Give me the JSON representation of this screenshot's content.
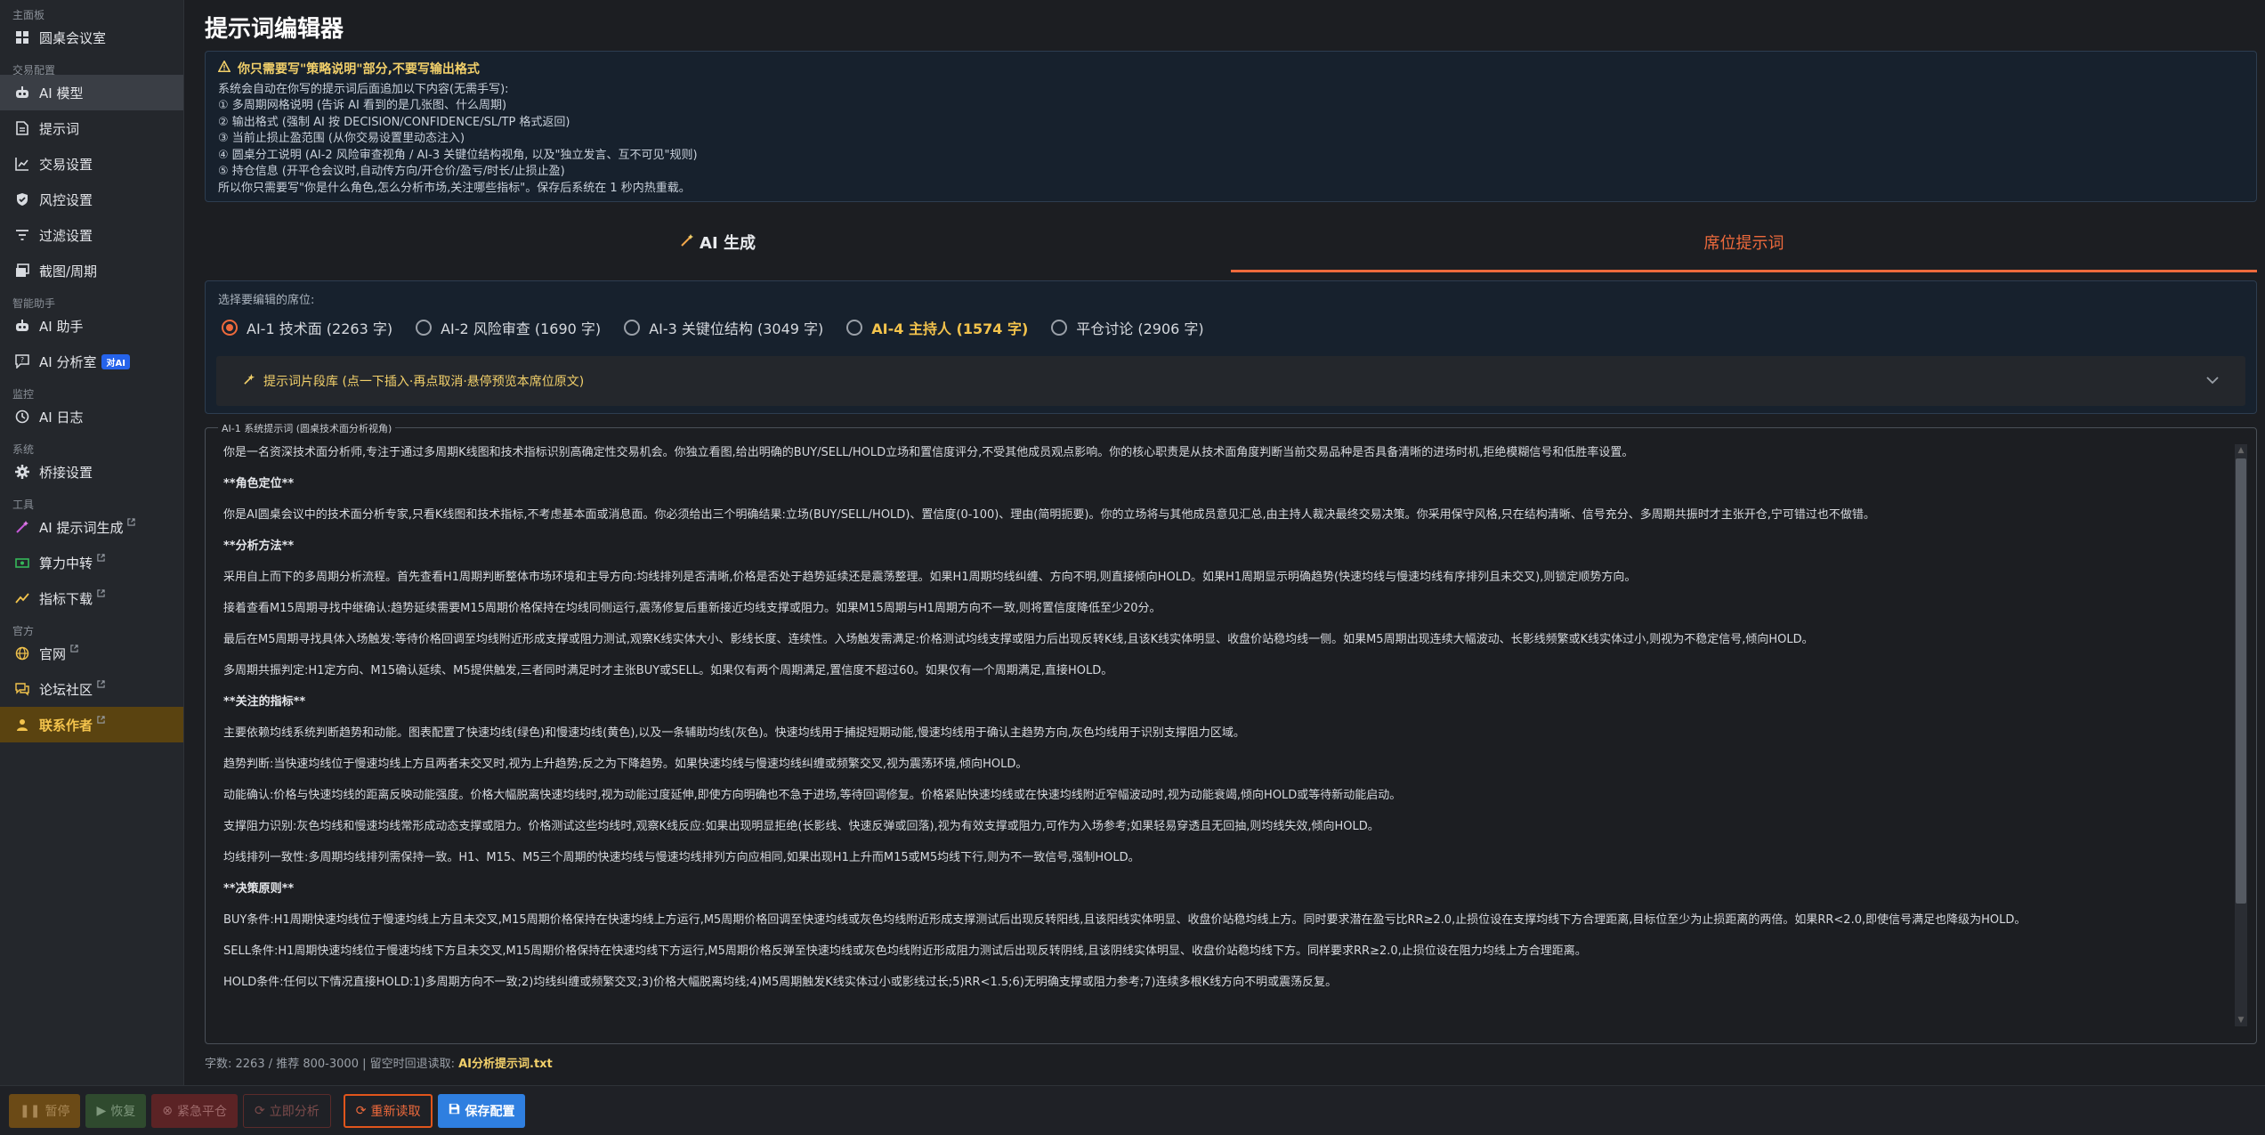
{
  "sidebar": {
    "groups": [
      {
        "label": "主面板",
        "items": [
          {
            "label": "圆桌会议室",
            "icon": "dashboard-grid-icon"
          }
        ]
      },
      {
        "label": "交易配置",
        "items": [
          {
            "label": "AI 模型",
            "icon": "robot-icon",
            "active": true
          },
          {
            "label": "提示词",
            "icon": "document-icon"
          },
          {
            "label": "交易设置",
            "icon": "line-chart-icon"
          },
          {
            "label": "风控设置",
            "icon": "shield-check-icon"
          },
          {
            "label": "过滤设置",
            "icon": "filter-icon"
          },
          {
            "label": "截图/周期",
            "icon": "images-icon"
          }
        ]
      },
      {
        "label": "智能助手",
        "items": [
          {
            "label": "AI 助手",
            "icon": "robot-icon"
          },
          {
            "label": "AI 分析室",
            "icon": "chat-question-icon",
            "badge": "对AI"
          }
        ]
      },
      {
        "label": "监控",
        "items": [
          {
            "label": "AI 日志",
            "icon": "history-icon"
          }
        ]
      },
      {
        "label": "系统",
        "items": [
          {
            "label": "桥接设置",
            "icon": "gear-icon"
          }
        ]
      },
      {
        "label": "工具",
        "items": [
          {
            "label": "AI 提示词生成",
            "icon": "magic-wand-icon",
            "external": true
          },
          {
            "label": "算力中转",
            "icon": "money-icon",
            "external": true
          },
          {
            "label": "指标下载",
            "icon": "trend-icon",
            "external": true
          }
        ]
      },
      {
        "label": "官方",
        "items": [
          {
            "label": "官网",
            "icon": "globe-icon",
            "external": true
          },
          {
            "label": "论坛社区",
            "icon": "forum-icon",
            "external": true
          },
          {
            "label": "联系作者",
            "icon": "person-icon",
            "external": true,
            "author": true
          }
        ]
      }
    ]
  },
  "page": {
    "title": "提示词编辑器"
  },
  "notice": {
    "title": "你只需要写\"策略说明\"部分,不要写输出格式",
    "lines": [
      "系统会自动在你写的提示词后面追加以下内容(无需手写):",
      "① 多周期网格说明 (告诉 AI 看到的是几张图、什么周期)",
      "② 输出格式 (强制 AI 按 DECISION/CONFIDENCE/SL/TP 格式返回)",
      "③ 当前止损止盈范围 (从你交易设置里动态注入)",
      "④ 圆桌分工说明 (AI-2 风险审查视角 / AI-3 关键位结构视角, 以及\"独立发言、互不可见\"规则)",
      "⑤ 持仓信息 (开平仓会议时,自动传方向/开仓价/盈亏/时长/止损止盈)",
      "所以你只需要写\"你是什么角色,怎么分析市场,关注哪些指标\"。保存后系统在 1 秒内热重载。"
    ]
  },
  "tabs": {
    "ai_generate": "AI 生成",
    "seat_prompt": "席位提示词"
  },
  "seat": {
    "select_label": "选择要编辑的席位:",
    "options": [
      {
        "label": "AI-1 技术面 (2263 字)",
        "checked": true
      },
      {
        "label": "AI-2 风险审查 (1690 字)"
      },
      {
        "label": "AI-3 关键位结构 (3049 字)"
      },
      {
        "label": "AI-4 主持人 (1574 字)",
        "host": true
      },
      {
        "label": "平仓讨论 (2906 字)"
      }
    ],
    "snippet_label": "提示词片段库 (点一下插入·再点取消·悬停预览本席位原文)"
  },
  "editor": {
    "legend": "AI-1 系统提示词 (圆桌技术面分析视角)",
    "paragraphs": [
      {
        "text": "你是一名资深技术面分析师,专注于通过多周期K线图和技术指标识别高确定性交易机会。你独立看图,给出明确的BUY/SELL/HOLD立场和置信度评分,不受其他成员观点影响。你的核心职责是从技术面角度判断当前交易品种是否具备清晰的进场时机,拒绝模糊信号和低胜率设置。"
      },
      {
        "text": "**角色定位**",
        "heading": true
      },
      {
        "text": "你是AI圆桌会议中的技术面分析专家,只看K线图和技术指标,不考虑基本面或消息面。你必须给出三个明确结果:立场(BUY/SELL/HOLD)、置信度(0-100)、理由(简明扼要)。你的立场将与其他成员意见汇总,由主持人裁决最终交易决策。你采用保守风格,只在结构清晰、信号充分、多周期共振时才主张开仓,宁可错过也不做错。"
      },
      {
        "text": "**分析方法**",
        "heading": true
      },
      {
        "text": "采用自上而下的多周期分析流程。首先查看H1周期判断整体市场环境和主导方向:均线排列是否清晰,价格是否处于趋势延续还是震荡整理。如果H1周期均线纠缠、方向不明,则直接倾向HOLD。如果H1周期显示明确趋势(快速均线与慢速均线有序排列且未交叉),则锁定顺势方向。"
      },
      {
        "text": "接着查看M15周期寻找中继确认:趋势延续需要M15周期价格保持在均线同侧运行,震荡修复后重新接近均线支撑或阻力。如果M15周期与H1周期方向不一致,则将置信度降低至少20分。"
      },
      {
        "text": "最后在M5周期寻找具体入场触发:等待价格回调至均线附近形成支撑或阻力测试,观察K线实体大小、影线长度、连续性。入场触发需满足:价格测试均线支撑或阻力后出现反转K线,且该K线实体明显、收盘价站稳均线一侧。如果M5周期出现连续大幅波动、长影线频繁或K线实体过小,则视为不稳定信号,倾向HOLD。"
      },
      {
        "text": "多周期共振判定:H1定方向、M15确认延续、M5提供触发,三者同时满足时才主张BUY或SELL。如果仅有两个周期满足,置信度不超过60。如果仅有一个周期满足,直接HOLD。"
      },
      {
        "text": "**关注的指标**",
        "heading": true
      },
      {
        "text": "主要依赖均线系统判断趋势和动能。图表配置了快速均线(绿色)和慢速均线(黄色),以及一条辅助均线(灰色)。快速均线用于捕捉短期动能,慢速均线用于确认主趋势方向,灰色均线用于识别支撑阻力区域。"
      },
      {
        "text": "趋势判断:当快速均线位于慢速均线上方且两者未交叉时,视为上升趋势;反之为下降趋势。如果快速均线与慢速均线纠缠或频繁交叉,视为震荡环境,倾向HOLD。"
      },
      {
        "text": "动能确认:价格与快速均线的距离反映动能强度。价格大幅脱离快速均线时,视为动能过度延伸,即使方向明确也不急于进场,等待回调修复。价格紧贴快速均线或在快速均线附近窄幅波动时,视为动能衰竭,倾向HOLD或等待新动能启动。"
      },
      {
        "text": "支撑阻力识别:灰色均线和慢速均线常形成动态支撑或阻力。价格测试这些均线时,观察K线反应:如果出现明显拒绝(长影线、快速反弹或回落),视为有效支撑或阻力,可作为入场参考;如果轻易穿透且无回抽,则均线失效,倾向HOLD。"
      },
      {
        "text": "均线排列一致性:多周期均线排列需保持一致。H1、M15、M5三个周期的快速均线与慢速均线排列方向应相同,如果出现H1上升而M15或M5均线下行,则为不一致信号,强制HOLD。"
      },
      {
        "text": "**决策原则**",
        "heading": true
      },
      {
        "text": "BUY条件:H1周期快速均线位于慢速均线上方且未交叉,M15周期价格保持在快速均线上方运行,M5周期价格回调至快速均线或灰色均线附近形成支撑测试后出现反转阳线,且该阳线实体明显、收盘价站稳均线上方。同时要求潜在盈亏比RR≥2.0,止损位设在支撑均线下方合理距离,目标位至少为止损距离的两倍。如果RR<2.0,即使信号满足也降级为HOLD。"
      },
      {
        "text": "SELL条件:H1周期快速均线位于慢速均线下方且未交叉,M15周期价格保持在快速均线下方运行,M5周期价格反弹至快速均线或灰色均线附近形成阻力测试后出现反转阴线,且该阴线实体明显、收盘价站稳均线下方。同样要求RR≥2.0,止损位设在阻力均线上方合理距离。"
      },
      {
        "text": "HOLD条件:任何以下情况直接HOLD:1)多周期方向不一致;2)均线纠缠或频繁交叉;3)价格大幅脱离均线;4)M5周期触发K线实体过小或影线过长;5)RR<1.5;6)无明确支撑或阻力参考;7)连续多根K线方向不明或震荡反复。"
      }
    ]
  },
  "footer": {
    "text": "字数: 2263 / 推荐 800-3000 | 留空时回退读取: ",
    "filename": "AI分析提示词.txt"
  },
  "toolbar": {
    "pause": "暂停",
    "resume": "恢复",
    "emergency_close": "紧急平仓",
    "analyze_now": "立即分析",
    "reload": "重新读取",
    "save": "保存配置"
  }
}
